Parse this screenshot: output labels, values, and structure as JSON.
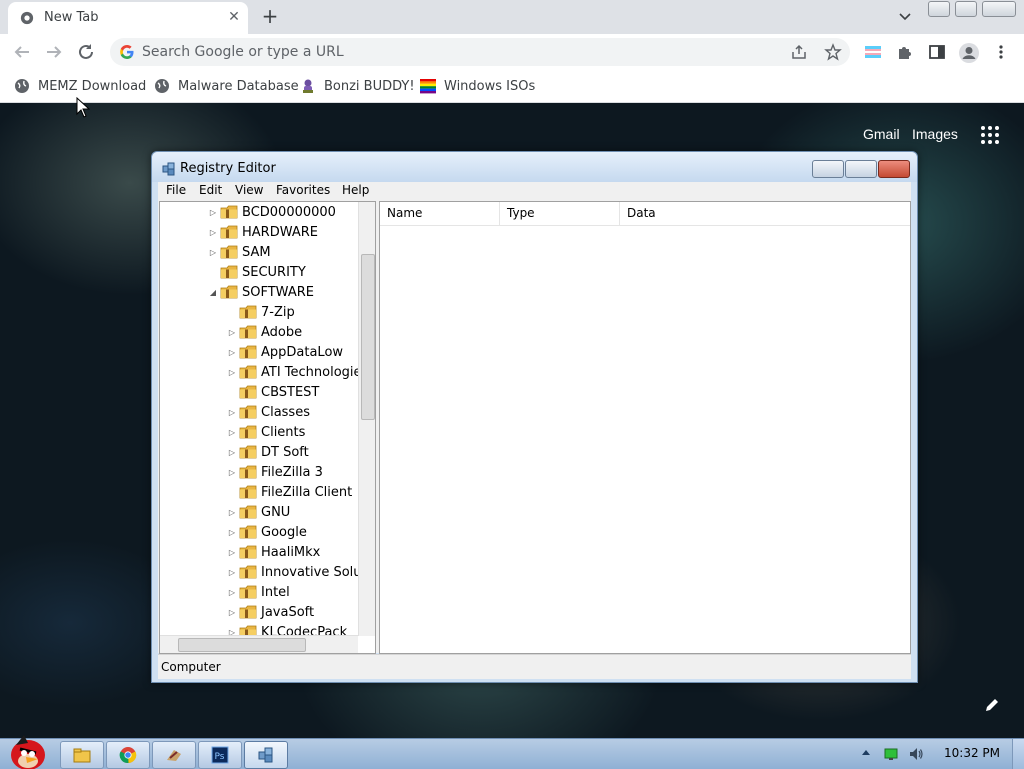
{
  "browser": {
    "tab": {
      "title": "New Tab"
    },
    "omnibox": {
      "placeholder": "Search Google or type a URL",
      "value": ""
    },
    "bookmarks": [
      {
        "label": "MEMZ Download",
        "icon": "globe-icon"
      },
      {
        "label": "Malware Database",
        "icon": "globe-icon"
      },
      {
        "label": "Bonzi BUDDY!",
        "icon": "bonzi-icon"
      },
      {
        "label": "Windows ISOs",
        "icon": "windows-flag-icon"
      }
    ]
  },
  "ntp": {
    "gmail": "Gmail",
    "images": "Images"
  },
  "regedit": {
    "title": "Registry Editor",
    "menu": [
      "File",
      "Edit",
      "View",
      "Favorites",
      "Help"
    ],
    "tree": [
      {
        "label": "BCD00000000",
        "level": 1,
        "expander": "closed"
      },
      {
        "label": "HARDWARE",
        "level": 1,
        "expander": "closed"
      },
      {
        "label": "SAM",
        "level": 1,
        "expander": "closed"
      },
      {
        "label": "SECURITY",
        "level": 1,
        "expander": "none"
      },
      {
        "label": "SOFTWARE",
        "level": 1,
        "expander": "open"
      },
      {
        "label": "7-Zip",
        "level": 2,
        "expander": "none"
      },
      {
        "label": "Adobe",
        "level": 2,
        "expander": "closed"
      },
      {
        "label": "AppDataLow",
        "level": 2,
        "expander": "closed"
      },
      {
        "label": "ATI Technologie",
        "level": 2,
        "expander": "closed"
      },
      {
        "label": "CBSTEST",
        "level": 2,
        "expander": "none"
      },
      {
        "label": "Classes",
        "level": 2,
        "expander": "closed"
      },
      {
        "label": "Clients",
        "level": 2,
        "expander": "closed"
      },
      {
        "label": "DT Soft",
        "level": 2,
        "expander": "closed"
      },
      {
        "label": "FileZilla 3",
        "level": 2,
        "expander": "closed"
      },
      {
        "label": "FileZilla Client",
        "level": 2,
        "expander": "none"
      },
      {
        "label": "GNU",
        "level": 2,
        "expander": "closed"
      },
      {
        "label": "Google",
        "level": 2,
        "expander": "closed"
      },
      {
        "label": "HaaliMkx",
        "level": 2,
        "expander": "closed"
      },
      {
        "label": "Innovative Soluti",
        "level": 2,
        "expander": "closed"
      },
      {
        "label": "Intel",
        "level": 2,
        "expander": "closed"
      },
      {
        "label": "JavaSoft",
        "level": 2,
        "expander": "closed"
      },
      {
        "label": "KLCodecPack",
        "level": 2,
        "expander": "closed"
      }
    ],
    "columns": [
      "Name",
      "Type",
      "Data"
    ],
    "status": "Computer"
  },
  "taskbar": {
    "buttons": [
      "explorer-icon",
      "chrome-icon",
      "app-icon",
      "photoshop-icon",
      "regedit-icon"
    ],
    "clock": "10:32 PM"
  }
}
